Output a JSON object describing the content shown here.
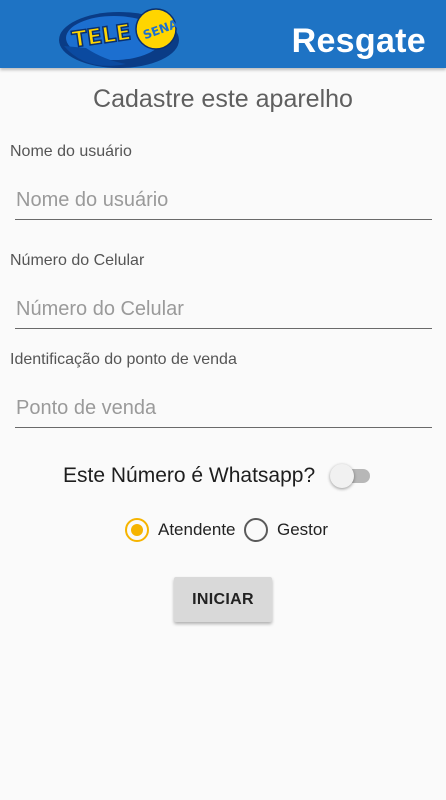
{
  "header": {
    "title": "Resgate",
    "logo_text_left": "TELE",
    "logo_text_right": "SENA",
    "background_color": "#1e73c4"
  },
  "form": {
    "title": "Cadastre este aparelho",
    "fields": [
      {
        "label": "Nome do usuário",
        "placeholder": "Nome do usuário",
        "value": ""
      },
      {
        "label": "Número do Celular",
        "placeholder": "Número do Celular",
        "value": ""
      },
      {
        "label": "Identificação do ponto de venda",
        "placeholder": "Ponto de venda",
        "value": ""
      }
    ],
    "whatsapp_switch": {
      "label": "Este Número é Whatsapp?",
      "checked": false
    },
    "role_options": [
      {
        "label": "Atendente",
        "selected": true
      },
      {
        "label": "Gestor",
        "selected": false
      }
    ],
    "accent_color": "#f6b400",
    "submit_label": "INICIAR"
  }
}
